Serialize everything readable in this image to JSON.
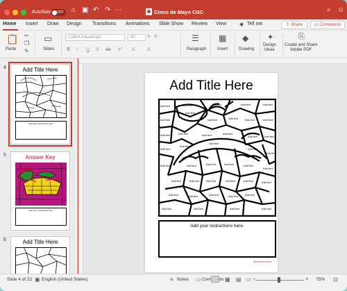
{
  "window": {
    "autosave_label": "AutoSave",
    "autosave_state": "OFF",
    "title": "Cinco de Mayo CBC",
    "colors": {
      "accent": "#c43d2f",
      "ribbon_bg": "#f3f2f1",
      "desktop_bg": "#7fd6c9"
    }
  },
  "toolbar_icons": [
    "home-icon",
    "save-icon",
    "undo-icon",
    "redo-icon",
    "more-icon"
  ],
  "tabs": [
    "Home",
    "Insert",
    "Draw",
    "Design",
    "Transitions",
    "Animations",
    "Slide Show",
    "Review",
    "View"
  ],
  "active_tab": "Home",
  "tell_me": "Tell me",
  "share_label": "Share",
  "comments_label": "Comments",
  "ribbon": {
    "paste": "Paste",
    "slides": "Slides",
    "font_name": "Calibri (Headings)",
    "font_size": "60",
    "paragraph": "Paragraph",
    "insert": "Insert",
    "drawing": "Drawing",
    "design_ideas": "Design\nIdeas",
    "create_share_pdf": "Create and Share\nAdobe PDF",
    "format_buttons": [
      "B",
      "I",
      "U",
      "S",
      "ab",
      "x²",
      "A",
      "A"
    ]
  },
  "thumbnails": [
    {
      "number": "4",
      "title": "Add Title Here",
      "footer": "Add your instructions here.",
      "selected": true
    },
    {
      "number": "5",
      "title": "Answer Key",
      "footer": "Add your instructions here.",
      "selected": false
    },
    {
      "number": "6",
      "title": "Add Title Here",
      "footer": "",
      "selected": false
    }
  ],
  "slide": {
    "title": "Add Title Here",
    "instructions": "Add your instructions here.",
    "brand": "@YourStoreHere",
    "cell_labels": [
      "Add text"
    ]
  },
  "status": {
    "slide_indicator": "Slide 4 of 22",
    "language": "English (United States)",
    "notes": "Notes",
    "comments": "Comments",
    "zoom": "75%"
  }
}
